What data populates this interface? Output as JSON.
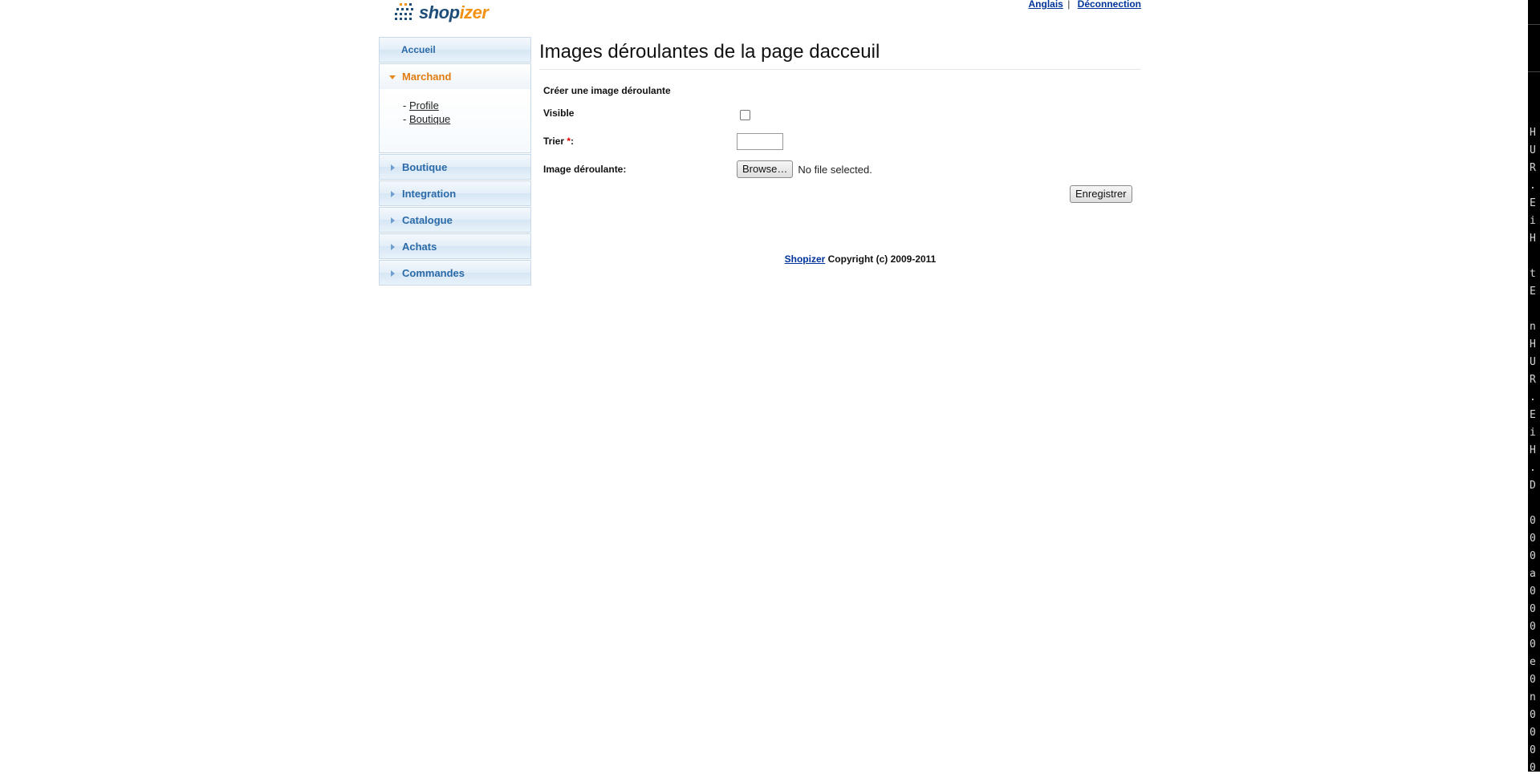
{
  "header": {
    "logo_text_a": "shop",
    "logo_text_b": "izer",
    "links": {
      "language": "Anglais",
      "separator": "|",
      "logout": "Déconnection"
    }
  },
  "sidebar": {
    "home": "Accueil",
    "sections": [
      {
        "label": "Marchand",
        "open": true,
        "items": [
          "Profile",
          "Boutique"
        ]
      },
      {
        "label": "Boutique"
      },
      {
        "label": "Integration"
      },
      {
        "label": "Catalogue"
      },
      {
        "label": "Achats"
      },
      {
        "label": "Commandes"
      }
    ],
    "item_prefix": "- "
  },
  "main": {
    "title": "Images déroulantes de la page dacceuil",
    "form_title": "Créer une image déroulante",
    "fields": {
      "visible_label": "Visible",
      "sort_label": "Trier",
      "sort_required": "*",
      "sort_colon": ":",
      "image_label": "Image déroulante:",
      "browse_label": "Browse…",
      "no_file": "No file selected.",
      "sort_value": ""
    },
    "save_label": "Enregistrer",
    "footer": {
      "link": "Shopizer",
      "text": " Copyright (c) 2009-2011"
    }
  },
  "terminal_chars": [
    "H",
    "U",
    "R",
    ".",
    "E",
    "i",
    "H",
    "",
    "t",
    "E",
    "",
    "n",
    "H",
    "U",
    "R",
    ".",
    "E",
    "i",
    "H",
    ".",
    "D",
    "",
    "0",
    "0",
    "0",
    "a",
    "0",
    "0",
    "0",
    "0",
    "e",
    "0",
    "n",
    "0",
    "0",
    "0",
    "0"
  ]
}
